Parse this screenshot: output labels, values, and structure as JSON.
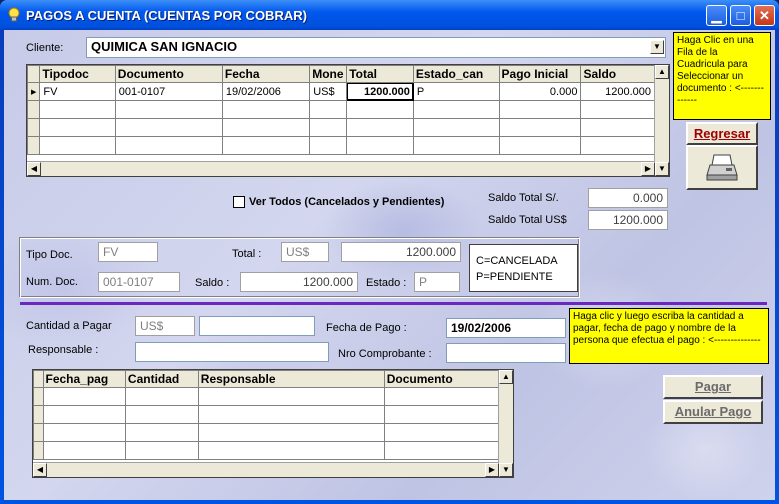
{
  "window": {
    "title": "PAGOS A CUENTA (CUENTAS POR COBRAR)"
  },
  "cliente": {
    "label": "Cliente:",
    "value": "QUIMICA SAN IGNACIO"
  },
  "grid1": {
    "headers": [
      "Tipodoc",
      "Documento",
      "Fecha",
      "Mone",
      "Total",
      "Estado_can",
      "Pago Inicial",
      "Saldo"
    ],
    "rows": [
      [
        "FV",
        "001-0107",
        "19/02/2006",
        "US$",
        "1200.000",
        "P",
        "0.000",
        "1200.000"
      ]
    ]
  },
  "notes": {
    "grid_help": "Haga Clic en una Fila de la Cuadricula para Seleccionar un documento : <-------------",
    "pay_help": "Haga clic y luego escriba la cantidad a pagar, fecha de pago y nombre de la persona que efectua el pago : <--------------"
  },
  "buttons": {
    "regresar": "Regresar",
    "pagar": "Pagar",
    "anular": "Anular Pago"
  },
  "ver_todos": "Ver Todos (Cancelados y Pendientes)",
  "totals": {
    "saldo_soles_label": "Saldo Total  S/.",
    "saldo_soles_value": "0.000",
    "saldo_dolares_label": "Saldo Total US$",
    "saldo_dolares_value": "1200.000"
  },
  "detail": {
    "tipo_doc_label": "Tipo Doc.",
    "tipo_doc_value": "FV",
    "num_doc_label": "Num. Doc.",
    "num_doc_value": "001-0107",
    "total_label": "Total :",
    "total_currency": "US$",
    "total_value": "1200.000",
    "saldo_label": "Saldo :",
    "saldo_value": "1200.000",
    "estado_label": "Estado :",
    "estado_value": "P",
    "legend_c": "C=CANCELADA",
    "legend_p": "P=PENDIENTE"
  },
  "payment": {
    "cantidad_label": "Cantidad a Pagar",
    "currency": "US$",
    "cantidad_value": "",
    "fecha_label": "Fecha de Pago :",
    "fecha_value": "19/02/2006",
    "responsable_label": "Responsable  :",
    "responsable_value": "",
    "comprobante_label": "Nro Comprobante :",
    "comprobante_value": ""
  },
  "grid2": {
    "headers": [
      "Fecha_pag",
      "Cantidad",
      "Responsable",
      "Documento"
    ]
  }
}
